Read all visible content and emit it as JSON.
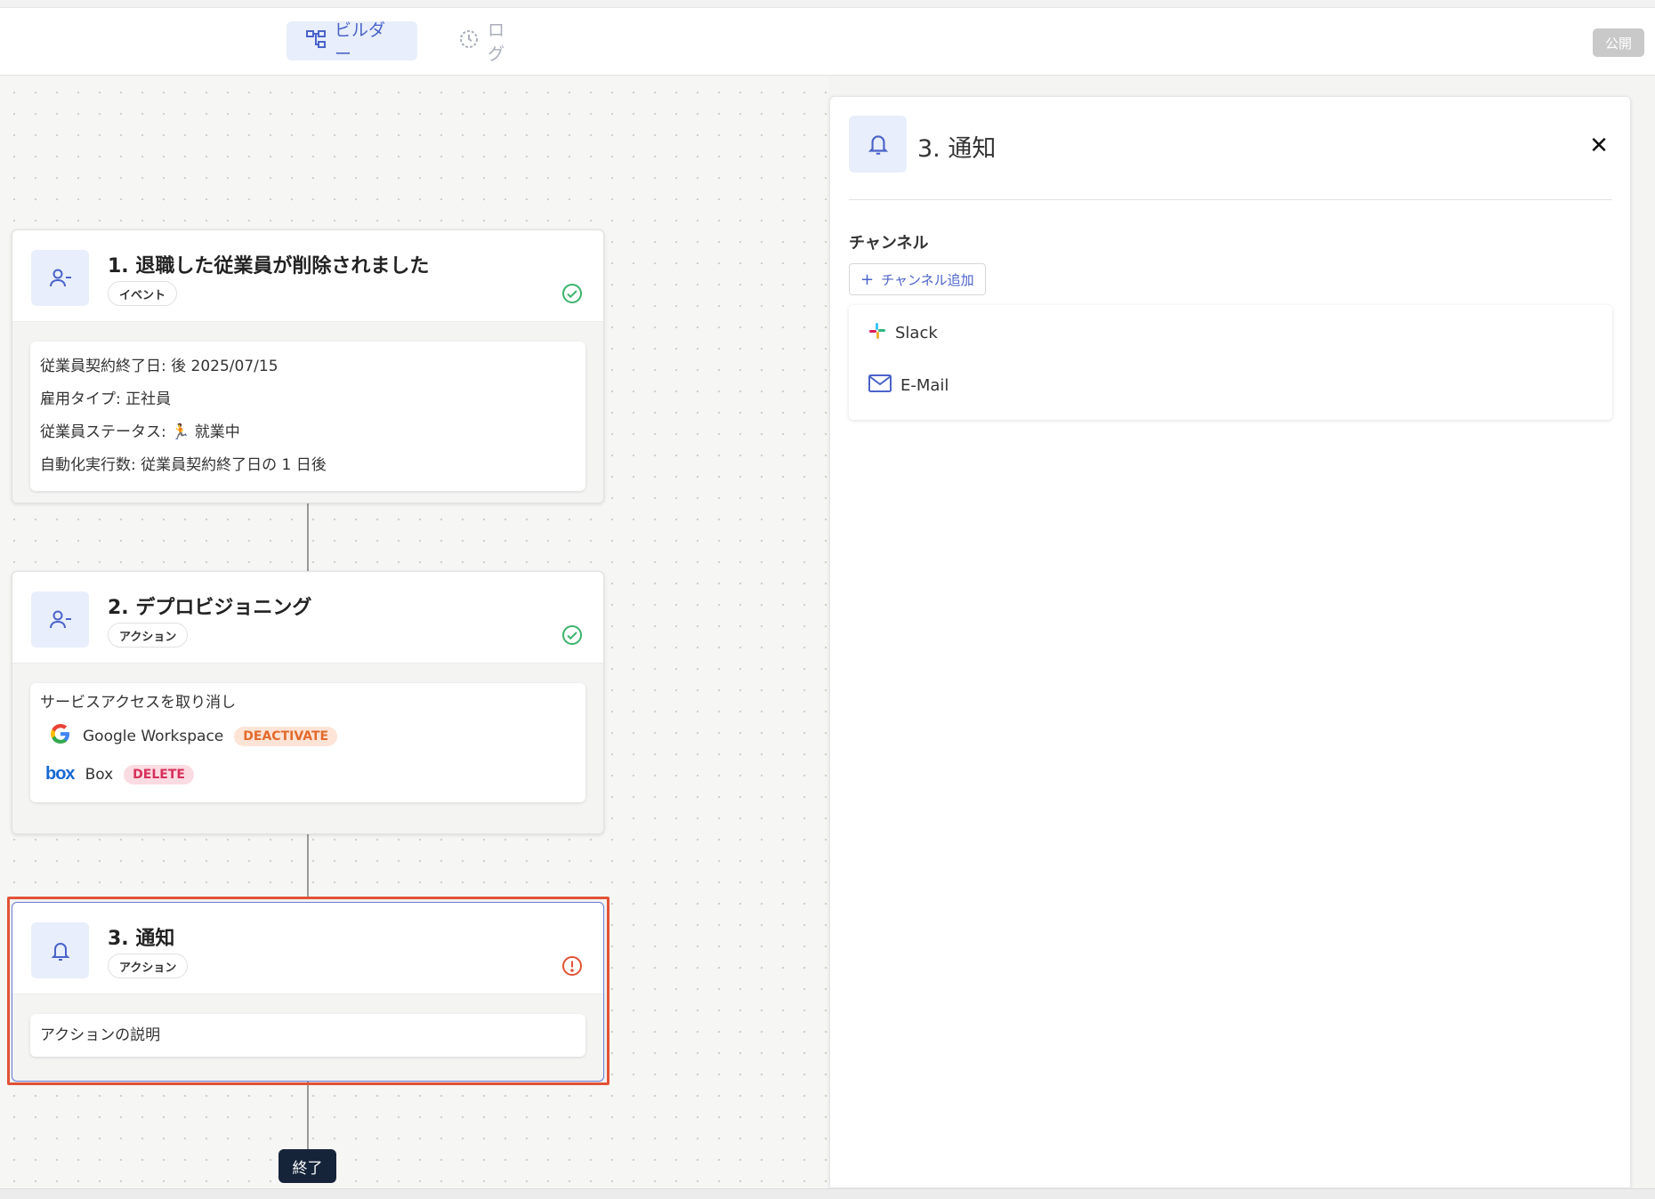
{
  "header": {
    "tabs": [
      {
        "label": "ビルダー",
        "active": true,
        "icon": "workflow-icon"
      },
      {
        "label": "ログ",
        "active": false,
        "icon": "history-icon"
      }
    ],
    "publish_label": "公開"
  },
  "nodes": [
    {
      "title": "1. 退職した従業員が削除されました",
      "type_label": "イベント",
      "icon": "user-remove-icon",
      "status": "complete",
      "conditions": [
        "従業員契約終了日: 後 2025/07/15",
        "雇用タイプ: 正社員",
        "従業員ステータス: 🏃 就業中",
        "自動化実行数: 従業員契約終了日の 1 日後"
      ]
    },
    {
      "title": "2. デプロビジョニング",
      "type_label": "アクション",
      "icon": "user-remove-icon",
      "status": "complete",
      "body_heading": "サービスアクセスを取り消し",
      "services": [
        {
          "name": "Google Workspace",
          "action": "DEACTIVATE",
          "icon": "google-icon",
          "color": "#e36a2c"
        },
        {
          "name": "Box",
          "action": "DELETE",
          "icon": "box-logo-icon",
          "color": "#d6305a"
        }
      ]
    },
    {
      "title": "3. 通知",
      "type_label": "アクション",
      "icon": "bell-icon",
      "status": "warning",
      "description": "アクションの説明",
      "selected": true
    }
  ],
  "end_label": "終了",
  "panel": {
    "title": "3. 通知",
    "icon": "bell-icon",
    "channel_label": "チャンネル",
    "add_channel_label": "チャンネル追加",
    "channels": [
      {
        "name": "Slack",
        "icon": "slack-icon"
      },
      {
        "name": "E-Mail",
        "icon": "mail-icon"
      }
    ]
  },
  "colors": {
    "accent": "#4a63c9",
    "success": "#3bb36a",
    "warning": "#e25236",
    "highlight_border": "#e25236"
  }
}
